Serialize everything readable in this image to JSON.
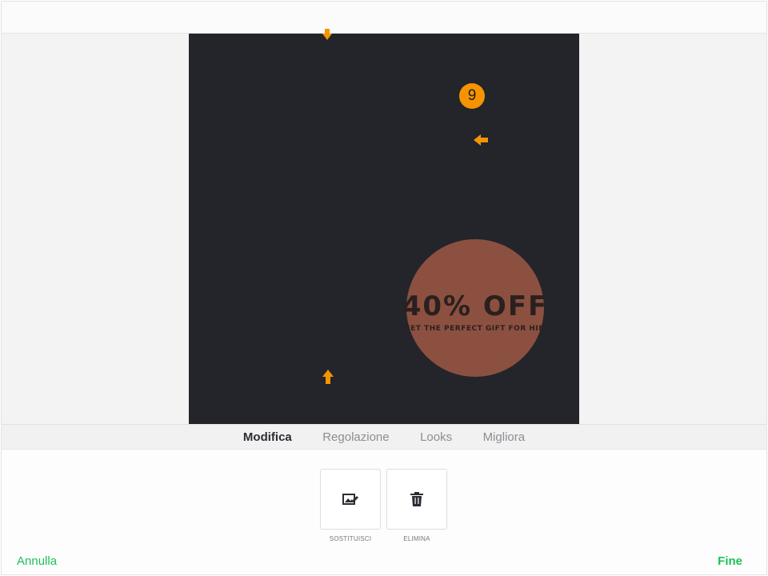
{
  "tabs": [
    {
      "label": "Modifica",
      "active": true
    },
    {
      "label": "Regolazione",
      "active": false
    },
    {
      "label": "Looks",
      "active": false
    },
    {
      "label": "Migliora",
      "active": false
    }
  ],
  "tools": {
    "replace": {
      "label": "SOSTITUISCI",
      "icon": "image-edit-icon"
    },
    "delete": {
      "label": "ELIMINA",
      "icon": "trash-icon"
    }
  },
  "actions": {
    "cancel_label": "Annulla",
    "done_label": "Fine"
  },
  "promo": {
    "headline": "40% OFF",
    "tagline": "GET THE PERFECT GIFT FOR HIM"
  },
  "step_badge": "9",
  "colors": {
    "accent_green": "#1ec05a",
    "callout_orange": "#f59400",
    "artboard_bg": "#24242b",
    "promo_circle": "#8c5040"
  }
}
